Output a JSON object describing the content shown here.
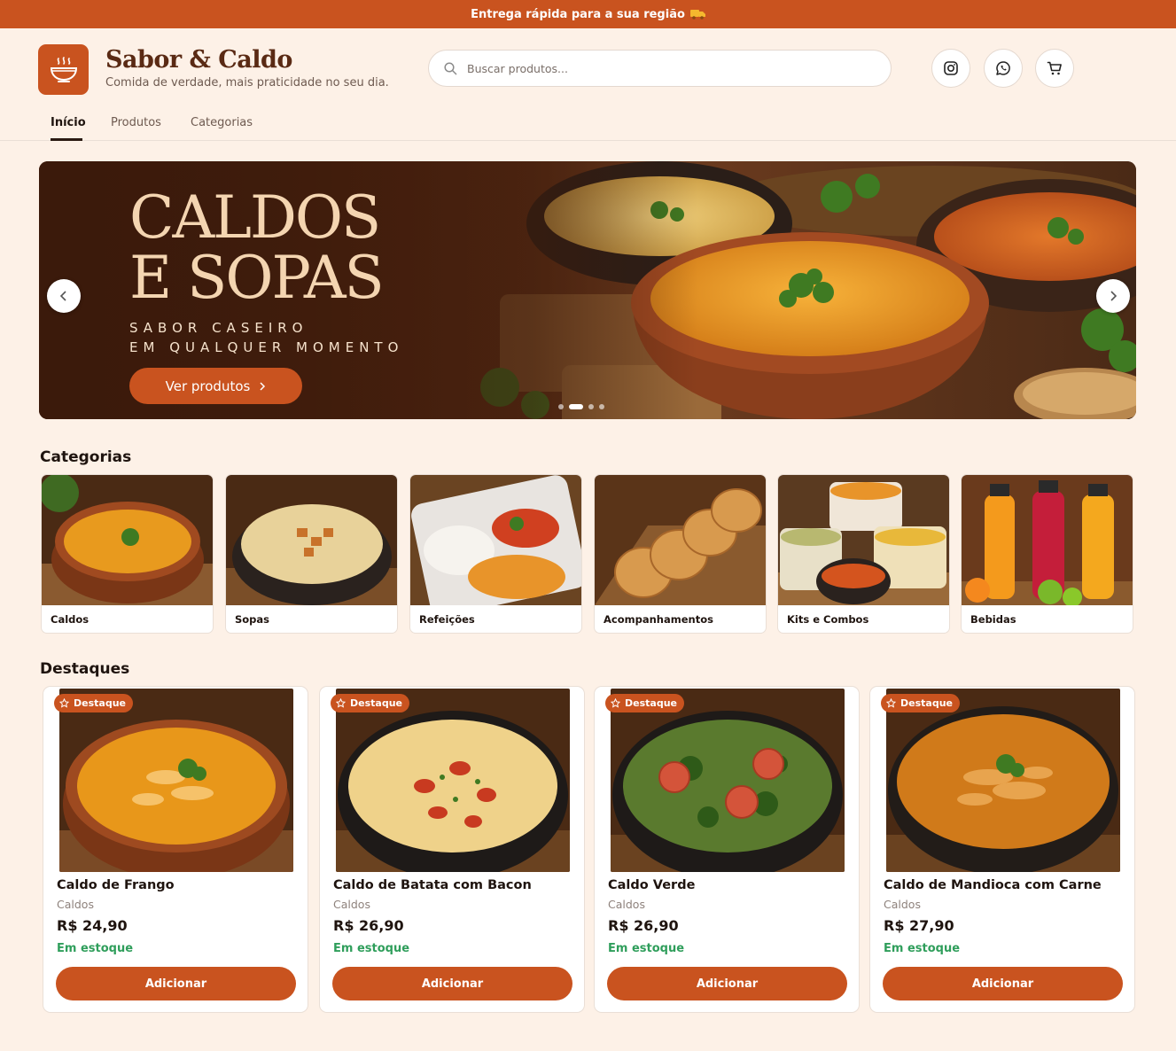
{
  "topbar": {
    "text": "Entrega rápida para a sua região",
    "icon": "truck-icon"
  },
  "brand": {
    "name": "Sabor & Caldo",
    "tagline": "Comida de verdade, mais praticidade no seu dia.",
    "icon": "soup-bowl-icon"
  },
  "search": {
    "placeholder": "Buscar produtos..."
  },
  "header_icons": [
    "instagram-icon",
    "whatsapp-icon",
    "cart-icon"
  ],
  "nav": {
    "items": [
      "Início",
      "Produtos",
      "Categorias"
    ],
    "active": "Início"
  },
  "hero": {
    "title": "CALDOS\nE SOPAS",
    "subtitle": "SABOR CASEIRO\nEM QUALQUER MOMENTO",
    "button": "Ver produtos",
    "slides_count": 4,
    "active_slide": 2
  },
  "categories": {
    "title": "Categorias",
    "items": [
      {
        "label": "Caldos"
      },
      {
        "label": "Sopas"
      },
      {
        "label": "Refeições"
      },
      {
        "label": "Acompanhamentos"
      },
      {
        "label": "Kits e Combos"
      },
      {
        "label": "Bebidas"
      }
    ]
  },
  "featured": {
    "title": "Destaques",
    "badge": "Destaque",
    "add_label": "Adicionar",
    "items": [
      {
        "name": "Caldo de Frango",
        "category": "Caldos",
        "price": "R$ 24,90",
        "stock": "Em estoque"
      },
      {
        "name": "Caldo de Batata com Bacon",
        "category": "Caldos",
        "price": "R$ 26,90",
        "stock": "Em estoque"
      },
      {
        "name": "Caldo Verde",
        "category": "Caldos",
        "price": "R$ 26,90",
        "stock": "Em estoque"
      },
      {
        "name": "Caldo de Mandioca com Carne",
        "category": "Caldos",
        "price": "R$ 27,90",
        "stock": "Em estoque"
      }
    ]
  },
  "colors": {
    "accent": "#c9531f",
    "background": "#fdf1e7",
    "stock": "#2f9e5b",
    "brand_text": "#5a2a14"
  }
}
